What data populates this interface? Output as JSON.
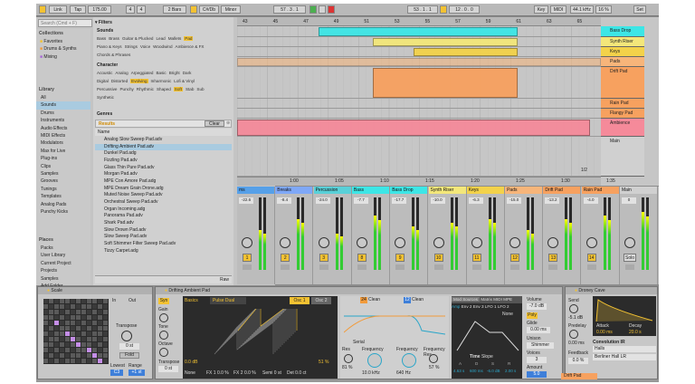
{
  "topbar": {
    "link": "Link",
    "tap": "Tap",
    "tempo": "175.00",
    "sig_num": "4",
    "sig_den": "4",
    "quantize": "2 Bars",
    "key": "C#/Db",
    "scale": "Minor",
    "position": "57 .  3 .  1",
    "loop_start": "53 .  1 .  1",
    "loop_len": "12 .  0 .  0",
    "key_label": "Key",
    "midi_label": "MIDI",
    "samplerate": "44.1 kHz",
    "cpu": "16 %",
    "set_label": "Set"
  },
  "browser": {
    "search_placeholder": "Search (Cmd + F)",
    "collections_title": "Collections",
    "collections": [
      "Favorites",
      "Drums & Synths",
      "Mixing"
    ],
    "library_title": "Library",
    "library": [
      "All",
      "Sounds",
      "Drums",
      "Instruments",
      "Audio Effects",
      "MIDI Effects",
      "Modulators",
      "Max for Live",
      "Plug-ins",
      "Clips",
      "Samples",
      "Grooves",
      "Tunings",
      "Templates",
      "Analog Pads",
      "Punchy Kicks"
    ],
    "places_title": "Places",
    "places": [
      "Packs",
      "User Library",
      "Current Project",
      "Projects",
      "Samples",
      "Add Folder..."
    ],
    "filters_label": "Filters",
    "sounds_label": "Sounds",
    "sounds_tags_1": [
      "Bass",
      "Brass",
      "Guitar & Plucked",
      "Lead",
      "Mallets",
      "Pad"
    ],
    "sounds_tags_2": [
      "Piano & Keys",
      "Strings",
      "Voice",
      "Woodwind",
      "Ambience & FX"
    ],
    "sounds_tags_3": [
      "Chords & Phrases"
    ],
    "character_label": "Character",
    "char_tags_1": [
      "Acoustic",
      "Analog",
      "Arpeggiated",
      "Basic",
      "Bright",
      "Dark"
    ],
    "char_tags_2": [
      "Digital",
      "Distorted",
      "Evolving",
      "Inharmonic",
      "Lofi & Vinyl"
    ],
    "char_tags_3": [
      "Percussive",
      "Punchy",
      "Rhythmic",
      "Shaped",
      "Soft",
      "Stab",
      "Sub"
    ],
    "char_tags_4": [
      "Synthetic"
    ],
    "genres_label": "Genres",
    "results_label": "Results",
    "clear_label": "Clear",
    "name_header": "Name",
    "files": [
      "Analog Slow Sweep Pad.adv",
      "Drifting Ambient Pad.adv",
      "Dunkel Pad.adg",
      "Fizzling Pad.adv",
      "Glass Thin Pure Pad.adv",
      "Morgan Pad.adv",
      "MPE Con Amore Pad.adg",
      "MPE Dream Grain Drone.adg",
      "Muted Noise Sweep Pad.adv",
      "Orchestral Sweep Pad.adv",
      "Organ Incoming.adg",
      "Panorama Pad.adv",
      "Shark Pad.adv",
      "Slow Drown Pad.adv",
      "Slow Sweep Pad.adv",
      "Soft Shimmer Filter Sweep Pad.adv",
      "Tizzy Carpet.adg"
    ],
    "preview_label": "Raw"
  },
  "arrangement": {
    "bars": [
      "43",
      "45",
      "47",
      "49",
      "51",
      "53",
      "55",
      "57",
      "59",
      "61",
      "63",
      "65"
    ],
    "times": [
      "1:00",
      "1:05",
      "1:10",
      "1:15",
      "1:20",
      "1:25",
      "1:30",
      "1:35"
    ],
    "page": "1/2",
    "tracks": [
      {
        "name": "Bass Drop",
        "color": "#3de6e6"
      },
      {
        "name": "Synth Riser",
        "color": "#f3e77a"
      },
      {
        "name": "Keys",
        "color": "#f3d24a"
      },
      {
        "name": "Pads",
        "color": "#f7b57a"
      },
      {
        "name": "Drift Pad",
        "color": "#f7a15f"
      },
      {
        "name": "Rain Pad",
        "color": "#f7a15f"
      },
      {
        "name": "Flangy Pad",
        "color": "#f7a15f"
      },
      {
        "name": "Ambience",
        "color": "#f58a9a"
      },
      {
        "name": "Main",
        "color": "#d0d0d0"
      }
    ]
  },
  "mixer": {
    "strips": [
      {
        "name": "ms",
        "num": "1",
        "vol": "-22.6",
        "meter": 0.55
      },
      {
        "name": "Breaks",
        "num": "2",
        "vol": "-8.4",
        "meter": 0.7
      },
      {
        "name": "Percussion",
        "num": "3",
        "vol": "-24.0",
        "meter": 0.5
      },
      {
        "name": "Bass",
        "num": "8",
        "vol": "-7.7",
        "meter": 0.75
      },
      {
        "name": "Bass Drop",
        "num": "9",
        "vol": "-17.7",
        "meter": 0.6
      },
      {
        "name": "Synth Riser",
        "num": "10",
        "vol": "-10.0",
        "meter": 0.65
      },
      {
        "name": "Keys",
        "num": "11",
        "vol": "-6.3",
        "meter": 0.7
      },
      {
        "name": "Pads",
        "num": "12",
        "vol": "-15.0",
        "meter": 0.55
      },
      {
        "name": "Drift Pad",
        "num": "13",
        "vol": "-13.2",
        "meter": 0.7
      },
      {
        "name": "Rain Pad",
        "num": "14",
        "vol": "-4.0",
        "meter": 0.75
      },
      {
        "name": "Main",
        "num": "",
        "vol": "0",
        "meter": 0.8
      }
    ],
    "solo_label": "Solo"
  },
  "devices": {
    "scale_title": "Scale",
    "in_label": "In",
    "out_label": "Out",
    "transpose_label": "Transpose",
    "transpose_val": "0 st",
    "fold_label": "Fold",
    "lowest_label": "Lowest",
    "range_label": "Range",
    "lowest_val": "C3",
    "range_val": "+1 st",
    "drift_title": "Drifting Ambient Pad",
    "syn_label": "Syn",
    "gain_label": "Gain",
    "tone_label": "Tone",
    "octave_label": "Octave",
    "octave_val": "0",
    "transpose2_label": "Transpose",
    "transpose2_val": "0 st",
    "basics_label": "Basics",
    "pulse_dual": "Pulse Dual",
    "osc1": "Osc 1",
    "osc2": "Osc 2",
    "fx1": "FX 1 0.0 %",
    "fx2": "FX 2 0.0 %",
    "semi": "Semi 0 st",
    "det": "Det 0.0 ct",
    "osc_db": "0.0 dB",
    "osc_pct": "51 %",
    "none_label": "None",
    "filter_a": "Clean",
    "filter_b": "Clean",
    "filt_num_a": "24",
    "filt_num_b": "12",
    "serial": "Serial",
    "res_label": "Res",
    "res_val": "81 %",
    "freq_label": "Frequency",
    "freq_val": "10.0 kHz",
    "freq2_label": "Frequency",
    "freq2_val": "640 Hz",
    "fres_label": "Frequency Res",
    "fres_val": "57 %",
    "mod_tabs": [
      "Mod Sources",
      "Matrix",
      "MIDI",
      "MPE"
    ],
    "mod_sub": [
      "Amp",
      "Env 2",
      "Env 3",
      "LFO 1",
      "LFO 2"
    ],
    "time_label": "Time",
    "slope_label": "Slope",
    "adsr": [
      "A",
      "D",
      "S",
      "R"
    ],
    "adsr_vals": [
      "4.63 s",
      "600 ms",
      "-6.0 dB",
      "2.00 s"
    ],
    "none2": "None",
    "volume_label": "Volume",
    "volume_val": "-7.0 dB",
    "poly_label": "Poly",
    "glide_label": "Glide",
    "glide_val": "0.00 ms",
    "unison_label": "Unison",
    "unison_val": "Shimmer",
    "voices_label": "Voices",
    "voices_val": "3",
    "amount_label": "Amount",
    "amount_val": "5.0",
    "drone_title": "Droney Cave",
    "send_label": "Send",
    "send_val": "-5.1 dB",
    "predelay_label": "Predelay",
    "predelay_val": "0.00 ms",
    "attack_label": "Attack",
    "decay_label": "Decay",
    "attack_val": "0.00 ms",
    "decay_val": "20.0 s",
    "ir_label": "Convolution IR",
    "ir_cat": "Halls",
    "ir_val": "Berliner Hall LR",
    "feedback_label": "Feedback",
    "feedback_val": "0.0 %"
  },
  "status": {
    "track": "Drift Pad"
  }
}
